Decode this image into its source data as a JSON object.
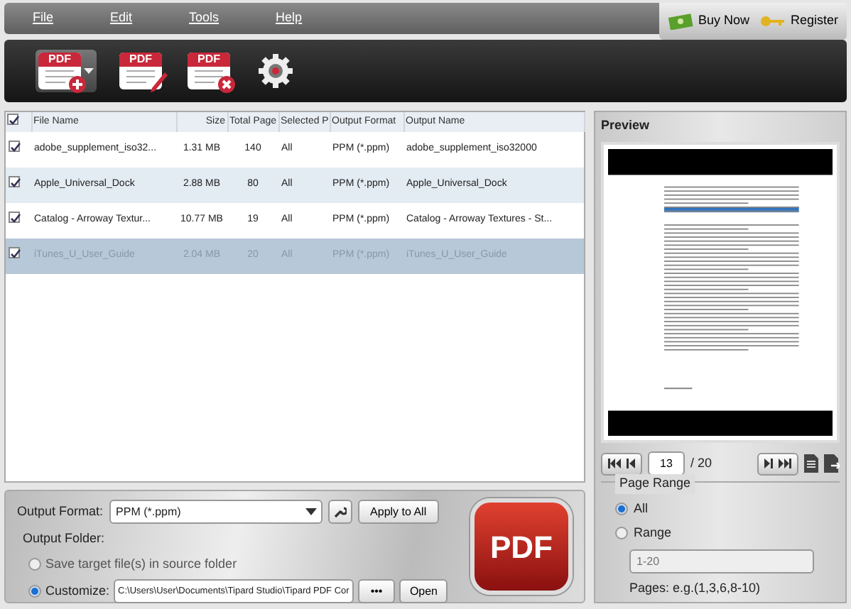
{
  "menu": [
    {
      "label": "File"
    },
    {
      "label": "Edit"
    },
    {
      "label": "Tools"
    },
    {
      "label": "Help"
    }
  ],
  "header_buttons": [
    {
      "label": "Buy Now",
      "kind": "cash"
    },
    {
      "label": "Register",
      "kind": "key"
    }
  ],
  "toolbar": [
    {
      "kind": "add",
      "label": "PDF",
      "dropdown": true
    },
    {
      "kind": "edit",
      "label": "PDF",
      "dropdown": false
    },
    {
      "kind": "remove",
      "label": "PDF",
      "dropdown": false
    },
    {
      "kind": "settings",
      "dropdown": false
    }
  ],
  "table": {
    "all_checked": true,
    "columns": [
      "File Name",
      "Size",
      "Total Page",
      "Selected P",
      "Output Format",
      "Output Name"
    ],
    "rows": [
      {
        "checked": true,
        "selected": false,
        "cells": [
          "adobe_supplement_iso32...",
          "1.31 MB",
          "140",
          "All",
          "PPM (*.ppm)",
          "adobe_supplement_iso32000"
        ]
      },
      {
        "checked": true,
        "selected": false,
        "cells": [
          "Apple_Universal_Dock",
          "2.88 MB",
          "80",
          "All",
          "PPM (*.ppm)",
          "Apple_Universal_Dock"
        ]
      },
      {
        "checked": true,
        "selected": false,
        "cells": [
          "Catalog - Arroway Textur...",
          "10.77 MB",
          "19",
          "All",
          "PPM (*.ppm)",
          "Catalog - Arroway Textures - St..."
        ]
      },
      {
        "checked": true,
        "selected": true,
        "cells": [
          "iTunes_U_User_Guide",
          "2.04 MB",
          "20",
          "All",
          "PPM (*.ppm)",
          "iTunes_U_User_Guide"
        ]
      }
    ]
  },
  "output": {
    "format_label": "Output Format:",
    "format_value": "PPM (*.ppm)",
    "apply_button": "Apply to All",
    "folder_label": "Output Folder:",
    "options": [
      {
        "label": "Save target file(s) in source folder",
        "selected": false
      },
      {
        "label": "Customize:",
        "selected": true
      }
    ],
    "path": "C:\\Users\\User\\Documents\\Tipard Studio\\Tipard PDF Cor",
    "browse_button": "•••",
    "open_button": "Open"
  },
  "convert_button": {
    "label": "PDF"
  },
  "preview": {
    "title": "Preview",
    "page": "13",
    "total": "/ 20",
    "range_title": "Page Range",
    "range_options": [
      {
        "label": "All",
        "selected": true
      },
      {
        "label": "Range",
        "selected": false
      }
    ],
    "range_placeholder": "1-20",
    "hint": "Pages: e.g.(1,3,6,8-10)"
  }
}
